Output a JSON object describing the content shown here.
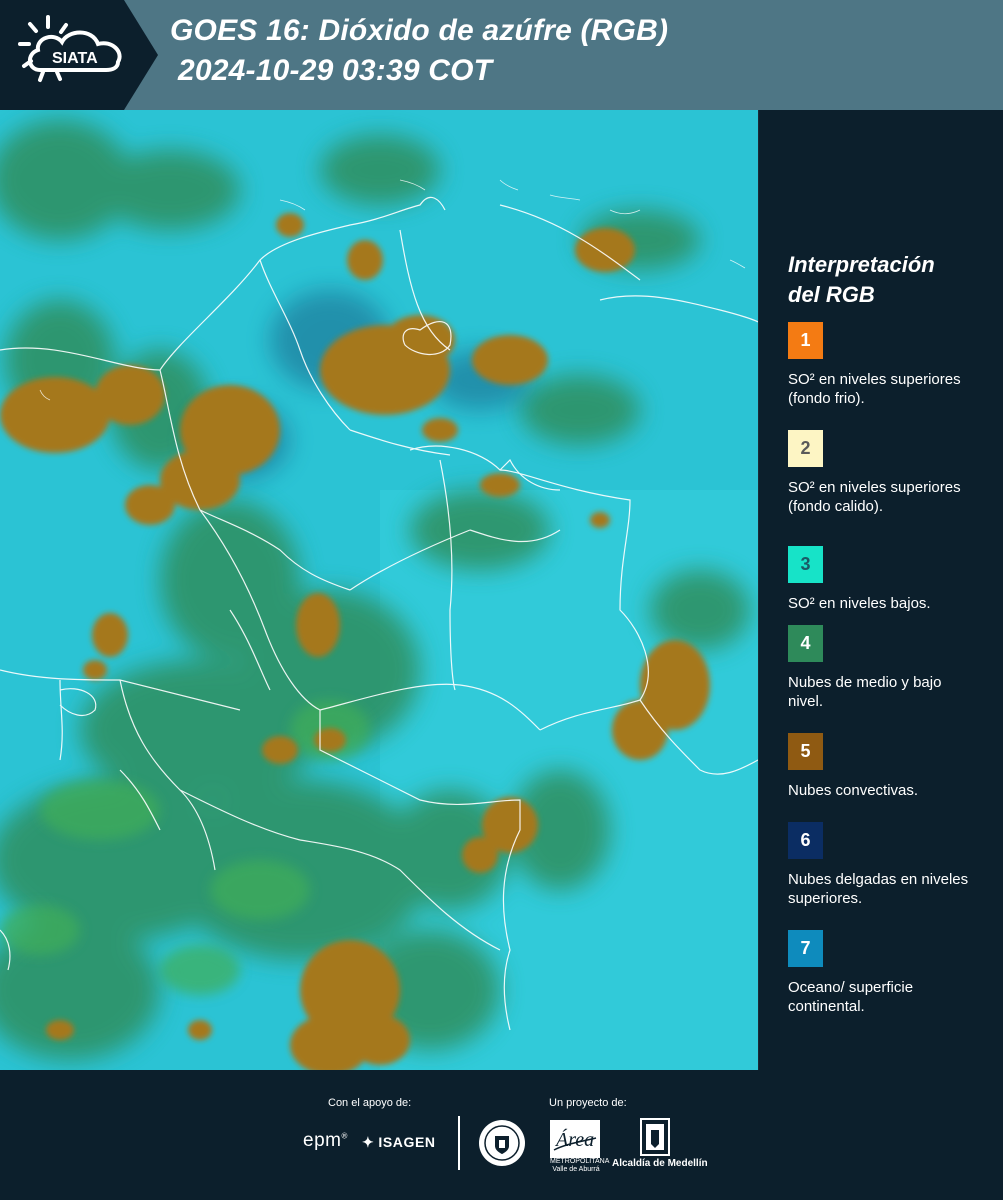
{
  "header": {
    "logo_text": "SIATA",
    "title_line1": "GOES 16: Dióxido de azúfre (RGB)",
    "title_line2": "2024-10-29 03:39 COT",
    "background_color": "#4e7685"
  },
  "map": {
    "image": "GOES 16 sulfur dioxide RGB composite over Colombia",
    "ocean_color": "#2bc3d4",
    "boundary_color": "#ffffff"
  },
  "legend": {
    "title_line1": "Interpretación",
    "title_line2": "del RGB",
    "items": [
      {
        "number": "1",
        "color": "#f47b13",
        "text_color": "#ffffff",
        "label": "SO² en niveles superiores (fondo frio)."
      },
      {
        "number": "2",
        "color": "#fdf5c4",
        "text_color": "#5a5a5a",
        "label": "SO² en niveles superiores (fondo calido)."
      },
      {
        "number": "3",
        "color": "#17e3c8",
        "text_color": "#1a5a66",
        "label": "SO² en niveles bajos."
      },
      {
        "number": "4",
        "color": "#2e8a5a",
        "text_color": "#ffffff",
        "label": "Nubes de medio y bajo nivel."
      },
      {
        "number": "5",
        "color": "#8f5a12",
        "text_color": "#ffffff",
        "label": "Nubes convectivas."
      },
      {
        "number": "6",
        "color": "#0b2d63",
        "text_color": "#ffffff",
        "label": "Nubes delgadas en niveles superiores."
      },
      {
        "number": "7",
        "color": "#0e8bbd",
        "text_color": "#ffffff",
        "label": "Oceano/ superficie continental."
      }
    ]
  },
  "footer": {
    "support_caption": "Con el apoyo de:",
    "project_caption": "Un proyecto de:",
    "epm": "epm",
    "isagen": "ISAGEN",
    "area_name": "Área",
    "area_subtitle": "METROPOLITANA Valle de Aburrá",
    "alcaldia": "Alcaldía de Medellín"
  }
}
